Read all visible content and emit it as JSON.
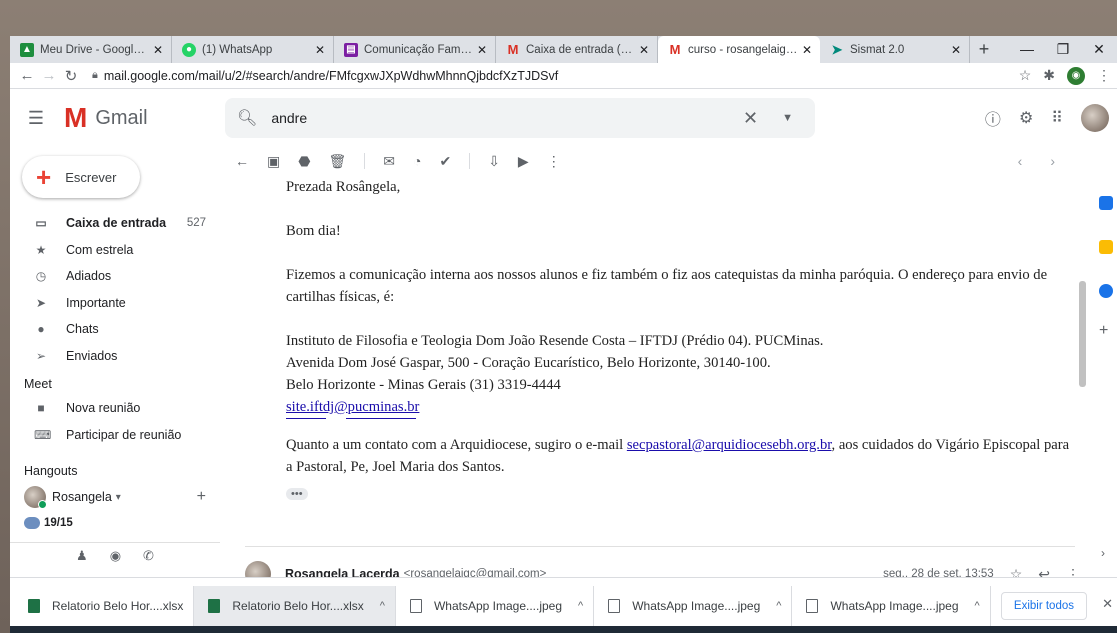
{
  "tabs": [
    {
      "label": "Meu Drive - Google Dr",
      "favicon": "drive-icon",
      "color": "#1e8e3e"
    },
    {
      "label": "(1) WhatsApp",
      "favicon": "whatsapp-icon",
      "color": "#25d366"
    },
    {
      "label": "Comunicação Família - ",
      "favicon": "sheets-icon",
      "color": "#7b1fa2"
    },
    {
      "label": "Caixa de entrada (585)",
      "favicon": "gmail-icon",
      "color": "#d93025"
    },
    {
      "label": "curso - rosangelaigc@",
      "favicon": "gmail-icon",
      "color": "#d93025",
      "active": true
    },
    {
      "label": "Sismat 2.0",
      "favicon": "sismat-icon",
      "color": "#00897b"
    }
  ],
  "browser": {
    "url": "mail.google.com/mail/u/2/#search/andre/FMfcgxwJXpWdhwMhnnQjbdcfXzTJDSvf"
  },
  "gmail": {
    "logo_text": "Gmail",
    "search_value": "andre",
    "compose_label": "Escrever"
  },
  "nav": [
    {
      "label": "Caixa de entrada",
      "count": "527",
      "icon": "inbox-icon",
      "bold": true
    },
    {
      "label": "Com estrela",
      "icon": "star-icon"
    },
    {
      "label": "Adiados",
      "icon": "clock-icon"
    },
    {
      "label": "Importante",
      "icon": "important-icon"
    },
    {
      "label": "Chats",
      "icon": "chat-icon"
    },
    {
      "label": "Enviados",
      "icon": "send-icon"
    }
  ],
  "meet": {
    "title": "Meet",
    "items": [
      {
        "label": "Nova reunião",
        "icon": "video-icon"
      },
      {
        "label": "Participar de reunião",
        "icon": "keyboard-icon"
      }
    ]
  },
  "hangouts": {
    "title": "Hangouts",
    "user": "Rosangela",
    "group": "19/15"
  },
  "message": {
    "greeting": "Prezada Rosângela,",
    "line1": "Bom dia!",
    "para1": "Fizemos a comunicação interna aos nossos alunos e fiz  também o fiz aos catequistas da minha paróquia. O endereço para envio de cartilhas físicas, é:",
    "addr1": "Instituto de Filosofia e Teologia Dom João Resende Costa – IFTDJ (Prédio 04). PUCMinas.",
    "addr2": "Avenida Dom José Gaspar, 500 - Coração Eucarístico, Belo Horizonte, 30140-100.",
    "addr3": "Belo Horizonte - Minas Gerais (31) 3319-4444",
    "site": "site.iftdj@pucminas.br",
    "para2_a": "Quanto a um contato com a Arquidiocese, sugiro o e-mail ",
    "para2_link": "secpastoral@arquidiocesebh.org.br",
    "para2_b": ", aos cuidados do Vigário Episcopal para a Pastoral, Pe, Joel Maria dos Santos.",
    "more": "•••"
  },
  "next_message": {
    "sender": "Rosangela Lacerda",
    "email": "<rosangelaigc@gmail.com>",
    "date": "seg., 28 de set. 13:53"
  },
  "downloads": [
    {
      "label": "Relatorio Belo Hor....xlsx",
      "type": "xlsx"
    },
    {
      "label": "Relatorio Belo Hor....xlsx",
      "type": "xlsx",
      "selected": true
    },
    {
      "label": "WhatsApp Image....jpeg",
      "type": "jpeg"
    },
    {
      "label": "WhatsApp Image....jpeg",
      "type": "jpeg"
    },
    {
      "label": "WhatsApp Image....jpeg",
      "type": "jpeg"
    }
  ],
  "show_all_label": "Exibir todos"
}
